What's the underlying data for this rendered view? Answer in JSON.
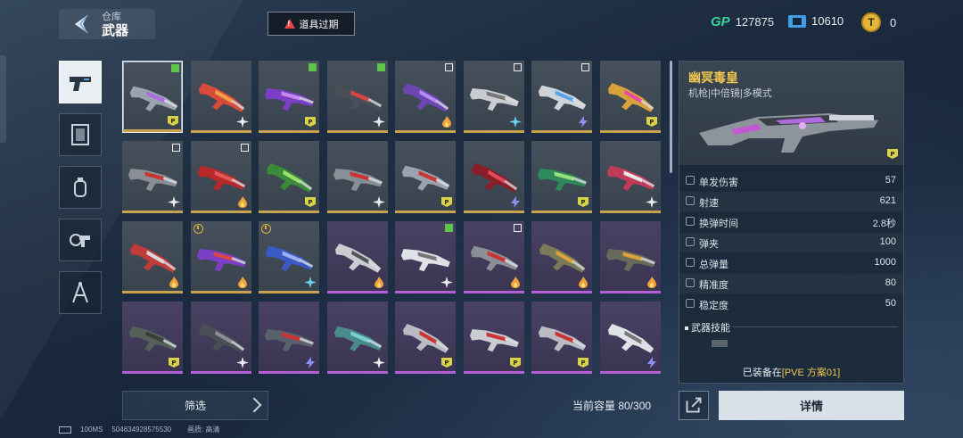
{
  "header": {
    "parent_label": "仓库",
    "title": "武器",
    "warning_label": "道具过期"
  },
  "currencies": [
    {
      "icon": "gp-icon",
      "value": "127875"
    },
    {
      "icon": "ticket-icon",
      "value": "10610"
    },
    {
      "icon": "coin-icon",
      "value": "0"
    }
  ],
  "categories": [
    {
      "icon": "pistol-icon",
      "active": true
    },
    {
      "icon": "frame-icon",
      "active": false
    },
    {
      "icon": "grenade-icon",
      "active": false
    },
    {
      "icon": "gear-gun-icon",
      "active": false
    },
    {
      "icon": "compass-icon",
      "active": false
    }
  ],
  "grid": {
    "items": [
      {
        "color": "#9aa3ad",
        "accent": "#b06be0",
        "tick": "g",
        "mode": "pve",
        "bar": "gold",
        "selected": true
      },
      {
        "color": "#d84a3a",
        "accent": "#f2a04a",
        "tick": "",
        "mode": "star",
        "bar": "gold"
      },
      {
        "color": "#7a3fc4",
        "accent": "#c48af0",
        "tick": "g",
        "mode": "pve",
        "bar": "gold"
      },
      {
        "color": "#4a4f57",
        "accent": "#d44",
        "tick": "g",
        "mode": "star",
        "bar": "gold"
      },
      {
        "color": "#6b48b0",
        "accent": "#b28af0",
        "tick": "w",
        "mode": "fire",
        "bar": "gold"
      },
      {
        "color": "#c9ccd1",
        "accent": "#777",
        "tick": "w",
        "mode": "star-blue",
        "bar": "gold"
      },
      {
        "color": "#cfd4da",
        "accent": "#5aa6e8",
        "tick": "w",
        "mode": "bolt",
        "bar": "gold"
      },
      {
        "color": "#d8a23a",
        "accent": "#e84aa6",
        "tick": "",
        "mode": "pve",
        "bar": "gold"
      },
      {
        "color": "#8a8f96",
        "accent": "#c33",
        "tick": "w",
        "mode": "star",
        "bar": "gold"
      },
      {
        "color": "#b82a2a",
        "accent": "#e05a5a",
        "tick": "w",
        "mode": "fire",
        "bar": "gold"
      },
      {
        "color": "#3a8a3a",
        "accent": "#9ae06a",
        "tick": "",
        "mode": "pve",
        "bar": "gold"
      },
      {
        "color": "#8a8f96",
        "accent": "#c33",
        "tick": "",
        "mode": "star",
        "bar": "gold"
      },
      {
        "color": "#9aa3ad",
        "accent": "#c33",
        "tick": "",
        "mode": "pve",
        "bar": "gold"
      },
      {
        "color": "#8a1f2a",
        "accent": "#e04a5a",
        "tick": "",
        "mode": "bolt",
        "bar": "gold"
      },
      {
        "color": "#2e8a5a",
        "accent": "#9ae07a",
        "tick": "",
        "mode": "pve",
        "bar": "gold"
      },
      {
        "color": "#c23a5a",
        "accent": "#e8e8e8",
        "tick": "",
        "mode": "star",
        "bar": "gold"
      },
      {
        "color": "#c23a3a",
        "accent": "#d9d9d9",
        "tick": "",
        "mode": "fire",
        "bar": "gold"
      },
      {
        "color": "#7a3fc4",
        "accent": "#d44",
        "clock": true,
        "mode": "fire",
        "bar": "gold"
      },
      {
        "color": "#3a5ac4",
        "accent": "#9ab0f0",
        "clock": true,
        "mode": "star-blue",
        "bar": "gold"
      },
      {
        "color": "#c9ccd1",
        "accent": "#555",
        "tick": "",
        "mode": "fire",
        "bar": "purple",
        "purple": true
      },
      {
        "color": "#dfe2e6",
        "accent": "#777",
        "tick": "g",
        "mode": "star",
        "bar": "purple",
        "purple": true
      },
      {
        "color": "#8a8f96",
        "accent": "#c33",
        "tick": "w",
        "mode": "fire",
        "bar": "purple",
        "purple": true
      },
      {
        "color": "#7a7a58",
        "accent": "#d9a23a",
        "tick": "",
        "mode": "fire",
        "bar": "purple",
        "purple": true
      },
      {
        "color": "#6a6a5a",
        "accent": "#d9a23a",
        "tick": "",
        "mode": "fire",
        "bar": "purple",
        "purple": true
      },
      {
        "color": "#55605a",
        "accent": "#3a4038",
        "tick": "",
        "mode": "pve",
        "bar": "purple",
        "purple": true
      },
      {
        "color": "#4a4f57",
        "accent": "#8a8f96",
        "tick": "",
        "mode": "star",
        "bar": "purple",
        "purple": true
      },
      {
        "color": "#5a606a",
        "accent": "#c33",
        "tick": "",
        "mode": "bolt",
        "bar": "purple",
        "purple": true
      },
      {
        "color": "#4a8a8a",
        "accent": "#7ad0d0",
        "tick": "",
        "mode": "star",
        "bar": "purple",
        "purple": true
      },
      {
        "color": "#b8bcc2",
        "accent": "#c33",
        "tick": "",
        "mode": "pve",
        "bar": "purple",
        "purple": true
      },
      {
        "color": "#c9ccd1",
        "accent": "#c33",
        "tick": "",
        "mode": "pve",
        "bar": "purple",
        "purple": true
      },
      {
        "color": "#b8bcc2",
        "accent": "#c33",
        "tick": "",
        "mode": "pve",
        "bar": "purple",
        "purple": true
      },
      {
        "color": "#dfe2e6",
        "accent": "#777",
        "tick": "",
        "mode": "bolt",
        "bar": "purple",
        "purple": true
      }
    ]
  },
  "detail": {
    "name": "幽冥毒皇",
    "type": "机枪|中倍镜|多模式",
    "stats": [
      {
        "label": "单发伤害",
        "value": "57"
      },
      {
        "label": "射速",
        "value": "621"
      },
      {
        "label": "换弹时间",
        "value": "2.8秒"
      },
      {
        "label": "弹夹",
        "value": "100"
      },
      {
        "label": "总弹量",
        "value": "1000"
      },
      {
        "label": "精准度",
        "value": "80"
      },
      {
        "label": "稳定度",
        "value": "50"
      }
    ],
    "skill_title": "武器技能",
    "equipped_prefix": "已装备在",
    "equipped_plan": "[PVE 方案01]"
  },
  "footer": {
    "filter_label": "筛选",
    "capacity_label": "当前容量 80/300",
    "details_label": "详情",
    "ping": "100MS",
    "uid": "504634928575530",
    "quality_label": "画质: 高清"
  }
}
